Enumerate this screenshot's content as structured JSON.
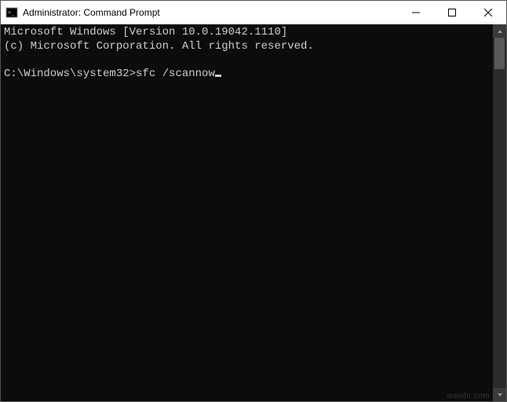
{
  "window": {
    "title": "Administrator: Command Prompt"
  },
  "console": {
    "line1": "Microsoft Windows [Version 10.0.19042.1110]",
    "line2": "(c) Microsoft Corporation. All rights reserved.",
    "blank": "",
    "prompt": "C:\\Windows\\system32>",
    "command": "sfc /scannow"
  },
  "watermark": "wsvdn.com"
}
